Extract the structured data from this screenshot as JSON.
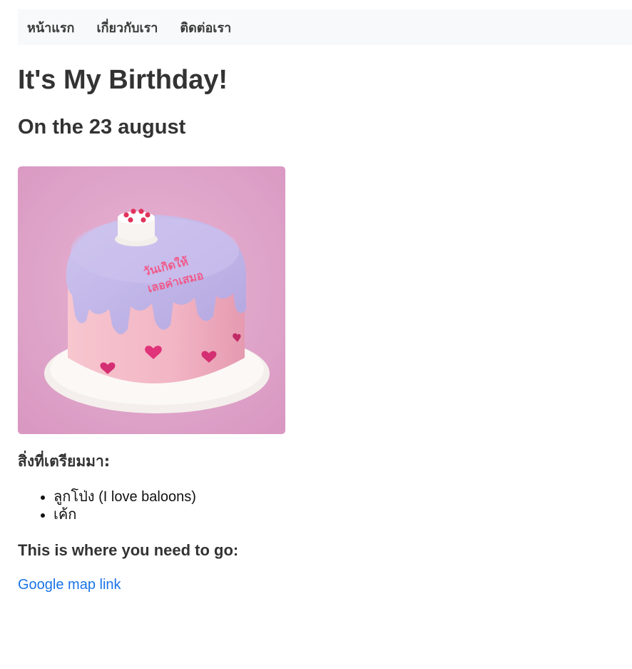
{
  "nav": {
    "items": [
      {
        "label": "หน้าแรก"
      },
      {
        "label": "เกี่ยวกับเรา"
      },
      {
        "label": "ติดต่อเรา"
      }
    ]
  },
  "main": {
    "title": "It's My Birthday!",
    "subtitle": "On the 23 august",
    "image": {
      "icon": "birthday-cake-photo",
      "cake_text_line1": "วันเกิดให้",
      "cake_text_line2": "เลอค่าเสมอ"
    },
    "prep_heading": "สิ่งที่เตรียมมา:",
    "prep_items": [
      "ลูกโป่ง (I love baloons)",
      "เค้ก"
    ],
    "where_heading": "This is where you need to go:",
    "map_link": "Google map link"
  },
  "colors": {
    "nav_bg": "#f8f9fa",
    "link": "#1a73e8",
    "text": "#333333",
    "photo_bg": "#e2a8cc",
    "frosting": "#c4b8e8",
    "cake_body": "#f3b9c8",
    "heart": "#e0337a"
  }
}
